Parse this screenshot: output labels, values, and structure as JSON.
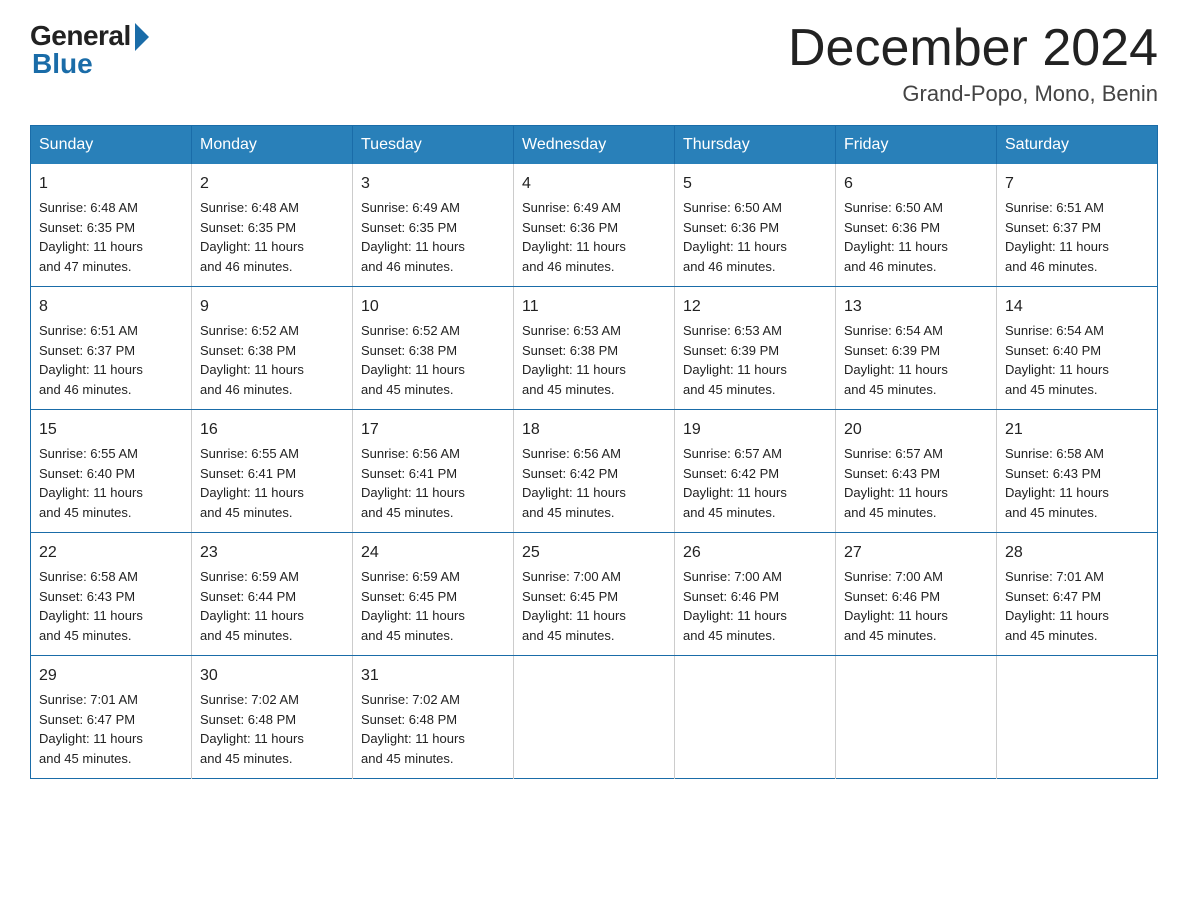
{
  "logo": {
    "general": "General",
    "blue": "Blue"
  },
  "header": {
    "month_title": "December 2024",
    "location": "Grand-Popo, Mono, Benin"
  },
  "weekdays": [
    "Sunday",
    "Monday",
    "Tuesday",
    "Wednesday",
    "Thursday",
    "Friday",
    "Saturday"
  ],
  "weeks": [
    [
      {
        "day": "1",
        "sunrise": "6:48 AM",
        "sunset": "6:35 PM",
        "daylight": "11 hours and 47 minutes."
      },
      {
        "day": "2",
        "sunrise": "6:48 AM",
        "sunset": "6:35 PM",
        "daylight": "11 hours and 46 minutes."
      },
      {
        "day": "3",
        "sunrise": "6:49 AM",
        "sunset": "6:35 PM",
        "daylight": "11 hours and 46 minutes."
      },
      {
        "day": "4",
        "sunrise": "6:49 AM",
        "sunset": "6:36 PM",
        "daylight": "11 hours and 46 minutes."
      },
      {
        "day": "5",
        "sunrise": "6:50 AM",
        "sunset": "6:36 PM",
        "daylight": "11 hours and 46 minutes."
      },
      {
        "day": "6",
        "sunrise": "6:50 AM",
        "sunset": "6:36 PM",
        "daylight": "11 hours and 46 minutes."
      },
      {
        "day": "7",
        "sunrise": "6:51 AM",
        "sunset": "6:37 PM",
        "daylight": "11 hours and 46 minutes."
      }
    ],
    [
      {
        "day": "8",
        "sunrise": "6:51 AM",
        "sunset": "6:37 PM",
        "daylight": "11 hours and 46 minutes."
      },
      {
        "day": "9",
        "sunrise": "6:52 AM",
        "sunset": "6:38 PM",
        "daylight": "11 hours and 46 minutes."
      },
      {
        "day": "10",
        "sunrise": "6:52 AM",
        "sunset": "6:38 PM",
        "daylight": "11 hours and 45 minutes."
      },
      {
        "day": "11",
        "sunrise": "6:53 AM",
        "sunset": "6:38 PM",
        "daylight": "11 hours and 45 minutes."
      },
      {
        "day": "12",
        "sunrise": "6:53 AM",
        "sunset": "6:39 PM",
        "daylight": "11 hours and 45 minutes."
      },
      {
        "day": "13",
        "sunrise": "6:54 AM",
        "sunset": "6:39 PM",
        "daylight": "11 hours and 45 minutes."
      },
      {
        "day": "14",
        "sunrise": "6:54 AM",
        "sunset": "6:40 PM",
        "daylight": "11 hours and 45 minutes."
      }
    ],
    [
      {
        "day": "15",
        "sunrise": "6:55 AM",
        "sunset": "6:40 PM",
        "daylight": "11 hours and 45 minutes."
      },
      {
        "day": "16",
        "sunrise": "6:55 AM",
        "sunset": "6:41 PM",
        "daylight": "11 hours and 45 minutes."
      },
      {
        "day": "17",
        "sunrise": "6:56 AM",
        "sunset": "6:41 PM",
        "daylight": "11 hours and 45 minutes."
      },
      {
        "day": "18",
        "sunrise": "6:56 AM",
        "sunset": "6:42 PM",
        "daylight": "11 hours and 45 minutes."
      },
      {
        "day": "19",
        "sunrise": "6:57 AM",
        "sunset": "6:42 PM",
        "daylight": "11 hours and 45 minutes."
      },
      {
        "day": "20",
        "sunrise": "6:57 AM",
        "sunset": "6:43 PM",
        "daylight": "11 hours and 45 minutes."
      },
      {
        "day": "21",
        "sunrise": "6:58 AM",
        "sunset": "6:43 PM",
        "daylight": "11 hours and 45 minutes."
      }
    ],
    [
      {
        "day": "22",
        "sunrise": "6:58 AM",
        "sunset": "6:43 PM",
        "daylight": "11 hours and 45 minutes."
      },
      {
        "day": "23",
        "sunrise": "6:59 AM",
        "sunset": "6:44 PM",
        "daylight": "11 hours and 45 minutes."
      },
      {
        "day": "24",
        "sunrise": "6:59 AM",
        "sunset": "6:45 PM",
        "daylight": "11 hours and 45 minutes."
      },
      {
        "day": "25",
        "sunrise": "7:00 AM",
        "sunset": "6:45 PM",
        "daylight": "11 hours and 45 minutes."
      },
      {
        "day": "26",
        "sunrise": "7:00 AM",
        "sunset": "6:46 PM",
        "daylight": "11 hours and 45 minutes."
      },
      {
        "day": "27",
        "sunrise": "7:00 AM",
        "sunset": "6:46 PM",
        "daylight": "11 hours and 45 minutes."
      },
      {
        "day": "28",
        "sunrise": "7:01 AM",
        "sunset": "6:47 PM",
        "daylight": "11 hours and 45 minutes."
      }
    ],
    [
      {
        "day": "29",
        "sunrise": "7:01 AM",
        "sunset": "6:47 PM",
        "daylight": "11 hours and 45 minutes."
      },
      {
        "day": "30",
        "sunrise": "7:02 AM",
        "sunset": "6:48 PM",
        "daylight": "11 hours and 45 minutes."
      },
      {
        "day": "31",
        "sunrise": "7:02 AM",
        "sunset": "6:48 PM",
        "daylight": "11 hours and 45 minutes."
      },
      null,
      null,
      null,
      null
    ]
  ]
}
